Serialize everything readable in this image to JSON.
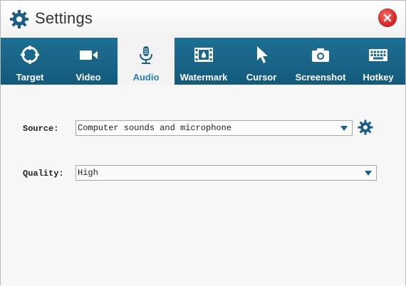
{
  "window": {
    "title": "Settings"
  },
  "tabs": [
    {
      "label": "Target",
      "icon": "target-icon"
    },
    {
      "label": "Video",
      "icon": "video-camera-icon"
    },
    {
      "label": "Audio",
      "icon": "microphone-icon",
      "active": true
    },
    {
      "label": "Watermark",
      "icon": "film-watermark-icon"
    },
    {
      "label": "Cursor",
      "icon": "cursor-icon"
    },
    {
      "label": "Screenshot",
      "icon": "camera-icon"
    },
    {
      "label": "Hotkey",
      "icon": "keyboard-icon"
    }
  ],
  "audio": {
    "source_label": "Source:",
    "source_value": "Computer sounds and microphone",
    "quality_label": "Quality:",
    "quality_value": "High"
  },
  "colors": {
    "tabbar": "#1a6789",
    "active_tab_text": "#2a7fb0",
    "close": "#d61f1f",
    "icon_blue": "#1b5f86"
  }
}
